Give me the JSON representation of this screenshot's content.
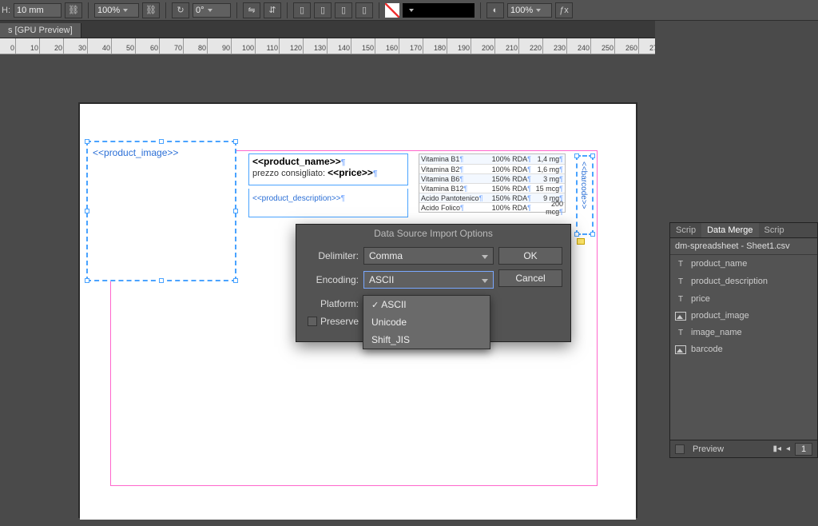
{
  "topbar": {
    "h_label": "H:",
    "h_value": "10 mm",
    "scale1": "100%",
    "shear": "0°",
    "scale2": "100%"
  },
  "doc_tab": "s [GPU Preview]",
  "ruler": {
    "start": -10,
    "step": 10,
    "count": 29
  },
  "canvas": {
    "product_image": "<<product_image>>",
    "product_name": "<<product_name>>",
    "price_label": "prezzo consigliato: ",
    "price": "<<price>>",
    "product_description": "<<product_description>>",
    "barcode": "<<barcode>>",
    "nutrition": [
      {
        "n": "Vitamina B1",
        "r": "100% RDA",
        "v": "1,4 mg"
      },
      {
        "n": "Vitamina B2",
        "r": "100% RDA",
        "v": "1,6 mg"
      },
      {
        "n": "Vitamina B6",
        "r": "150% RDA",
        "v": "3 mg"
      },
      {
        "n": "Vitamina B12",
        "r": "150% RDA",
        "v": "15 mcg"
      },
      {
        "n": "Acido Pantotenico",
        "r": "150% RDA",
        "v": "9 mg"
      },
      {
        "n": "Acido Folico",
        "r": "100% RDA",
        "v": "200 mcg"
      }
    ]
  },
  "dialog": {
    "title": "Data Source Import Options",
    "delimiter_label": "Delimiter:",
    "delimiter_value": "Comma",
    "encoding_label": "Encoding:",
    "encoding_value": "ASCII",
    "platform_label": "Platform:",
    "preserve_label": "Preserve",
    "ok": "OK",
    "cancel": "Cancel",
    "encoding_options": [
      "ASCII",
      "Unicode",
      "Shift_JIS"
    ]
  },
  "panel": {
    "tabs": [
      "Scrip",
      "Data Merge",
      "Scrip"
    ],
    "filename": "dm-spreadsheet - Sheet1.csv",
    "fields": [
      {
        "type": "T",
        "name": "product_name"
      },
      {
        "type": "T",
        "name": "product_description"
      },
      {
        "type": "T",
        "name": "price"
      },
      {
        "type": "I",
        "name": "product_image"
      },
      {
        "type": "T",
        "name": "image_name"
      },
      {
        "type": "I",
        "name": "barcode"
      }
    ],
    "preview": "Preview",
    "page": "1"
  }
}
